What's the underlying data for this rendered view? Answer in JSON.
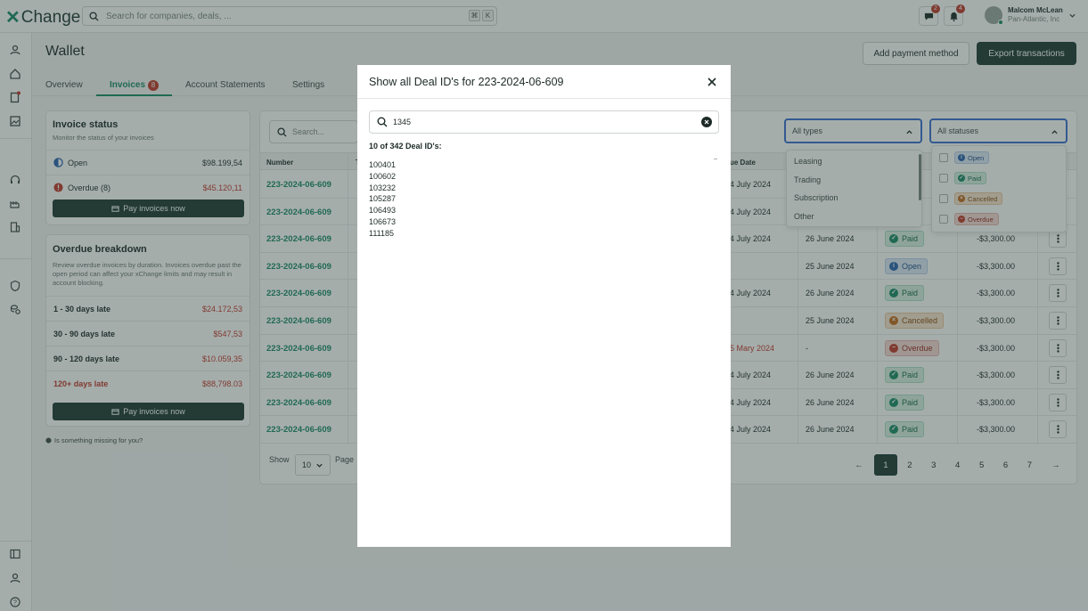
{
  "app": {
    "logo": "Change",
    "search_placeholder": "Search for companies, deals, ...",
    "kbd_cmd": "⌘",
    "kbd_k": "K"
  },
  "notifications": {
    "messages_count": "2",
    "alerts_count": "4"
  },
  "user": {
    "name": "Malcom McLean",
    "org": "Pan-Atlantic, Inc"
  },
  "page": {
    "title": "Wallet",
    "add_payment": "Add payment method",
    "export": "Export transactions"
  },
  "tabs": [
    {
      "label": "Overview"
    },
    {
      "label": "Invoices",
      "badge": "8"
    },
    {
      "label": "Account Statements"
    },
    {
      "label": "Settings"
    }
  ],
  "invoice_status": {
    "title": "Invoice status",
    "subtitle": "Monitor the status of your invoices",
    "open_label": "Open",
    "open_value": "$98.199,54",
    "overdue_label": "Overdue (8)",
    "overdue_value": "$45.120,11",
    "pay_button": "Pay invoices now"
  },
  "overdue_breakdown": {
    "title": "Overdue breakdown",
    "subtitle": "Review overdue invoices by duration. Invoices overdue past the open period can affect your xChange limits and may result in account blocking.",
    "rows": [
      {
        "label": "1 - 30 days late",
        "value": "$24.172,53"
      },
      {
        "label": "30 - 90 days late",
        "value": "$547,53"
      },
      {
        "label": "90 - 120 days late",
        "value": "$10.059,35"
      },
      {
        "label": "120+ days late",
        "value": "$88,798.03"
      }
    ],
    "pay_button": "Pay invoices now"
  },
  "missing_text": "Is something missing for you?",
  "table": {
    "search_placeholder": "Search...",
    "headers": {
      "number": "Number",
      "t": "T",
      "due": "ue Date"
    },
    "rows": [
      {
        "number": "223-2024-06-609",
        "due": "4 July 2024",
        "issued": "",
        "status": "",
        "amount": ""
      },
      {
        "number": "223-2024-06-609",
        "due": "4 July 2024",
        "issued": "",
        "status": "",
        "amount": ""
      },
      {
        "number": "223-2024-06-609",
        "due": "4 July 2024",
        "issued": "26 June 2024",
        "status": "Paid",
        "amount": "-$3,300.00"
      },
      {
        "number": "223-2024-06-609",
        "due": "",
        "issued": "25 June 2024",
        "status": "Open",
        "amount": "-$3,300.00"
      },
      {
        "number": "223-2024-06-609",
        "due": "4 July 2024",
        "issued": "26 June 2024",
        "status": "Paid",
        "amount": "-$3,300.00"
      },
      {
        "number": "223-2024-06-609",
        "due": "",
        "issued": "25 June 2024",
        "status": "Cancelled",
        "amount": "-$3,300.00"
      },
      {
        "number": "223-2024-06-609",
        "due": "5 Mary 2024",
        "issued": "-",
        "status": "Overdue",
        "amount": "-$3,300.00"
      },
      {
        "number": "223-2024-06-609",
        "due": "4 July 2024",
        "issued": "26 June 2024",
        "status": "Paid",
        "amount": "-$3,300.00"
      },
      {
        "number": "223-2024-06-609",
        "due": "4 July 2024",
        "issued": "26 June 2024",
        "status": "Paid",
        "amount": "-$3,300.00"
      },
      {
        "number": "223-2024-06-609",
        "due": "4 July 2024",
        "issued": "26 June 2024",
        "status": "Paid",
        "amount": "-$3,300.00"
      }
    ],
    "show_label": "Show",
    "show_value": "10",
    "page_label": "Page",
    "pages": [
      "1",
      "2",
      "3",
      "4",
      "5",
      "6",
      "7"
    ],
    "prev": "←",
    "next": "→"
  },
  "filters": {
    "types": {
      "label": "All types",
      "options": [
        "Leasing",
        "Trading",
        "Subscription",
        "Other"
      ]
    },
    "statuses": {
      "label": "All statuses",
      "options": [
        "Open",
        "Paid",
        "Cancelled",
        "Overdue"
      ]
    }
  },
  "modal": {
    "title": "Show all Deal ID's for 223-2024-06-609",
    "search_value": "1345",
    "count_text": "10 of 342 Deal ID's:",
    "ids": [
      "100401",
      "100602",
      "103232",
      "105287",
      "106493",
      "106673",
      "111185"
    ]
  },
  "colors": {
    "brand": "#1b8a68",
    "dark": "#1f3a34",
    "danger": "#c0392b",
    "focus": "#3b6fd1"
  }
}
